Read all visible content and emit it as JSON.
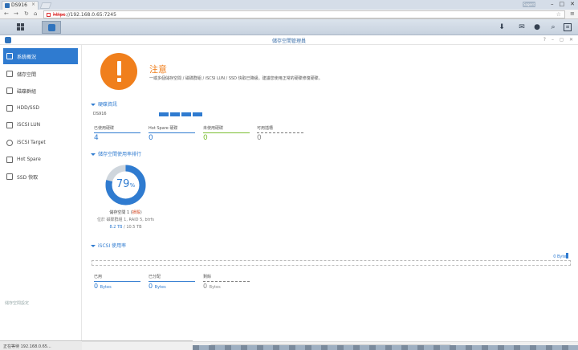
{
  "browser": {
    "tab_title": "DS916",
    "url_scheme": "https",
    "url_rest": "://192.168.0.65:7245",
    "user_badge": "Sagent"
  },
  "window": {
    "title": "儲存空間管理員"
  },
  "sidebar": {
    "items": [
      {
        "label": "系統概況",
        "icon": "overview-icon",
        "active": true
      },
      {
        "label": "儲存空間",
        "icon": "volume-icon"
      },
      {
        "label": "磁碟群組",
        "icon": "disk-group-icon"
      },
      {
        "label": "HDD/SSD",
        "icon": "hdd-icon"
      },
      {
        "label": "iSCSI LUN",
        "icon": "lun-icon"
      },
      {
        "label": "iSCSI Target",
        "icon": "target-icon"
      },
      {
        "label": "Hot Spare",
        "icon": "hot-spare-icon"
      },
      {
        "label": "SSD 快取",
        "icon": "ssd-cache-icon"
      }
    ],
    "footer": "儲存空間設定"
  },
  "status_text": "正在等待 192.168.0.65...",
  "alert": {
    "title": "注意",
    "description": "一或多個儲存空間 / 磁碟群組 / iSCSI LUN / SSD 快取已降級。建議您使用正常的硬碟修復硬碟。"
  },
  "hardware": {
    "heading": "硬碟資訊",
    "model": "DS916",
    "slots": 4,
    "stats": [
      {
        "label": "已使用硬碟",
        "value": "4"
      },
      {
        "label": "Hot Spare 硬碟",
        "value": "0"
      },
      {
        "label": "未使用硬碟",
        "value": "0"
      },
      {
        "label": "可用插槽",
        "value": "0"
      }
    ]
  },
  "volume_usage": {
    "heading": "儲存空間使用率排行",
    "percent": "79",
    "percent_value": 79,
    "percent_sign": "%",
    "name_prefix": "儲存空間 1 (",
    "name_status": "損毀",
    "name_suffix": ")",
    "detail": "位於 磁碟群組 1, RAID 5, btrfs",
    "used": "8.2 TB",
    "total": " / 10.5 TB",
    "colors": {
      "used": "#2f7bd0",
      "free": "#cfd6dd"
    }
  },
  "iscsi": {
    "heading": "iSCSI 使用率",
    "total_label": "0 Bytes",
    "stats": [
      {
        "label": "已用",
        "value": "0",
        "unit": "Bytes"
      },
      {
        "label": "已分配",
        "value": "0",
        "unit": "Bytes"
      },
      {
        "label": "剩餘",
        "value": "0",
        "unit": "Bytes"
      }
    ]
  }
}
